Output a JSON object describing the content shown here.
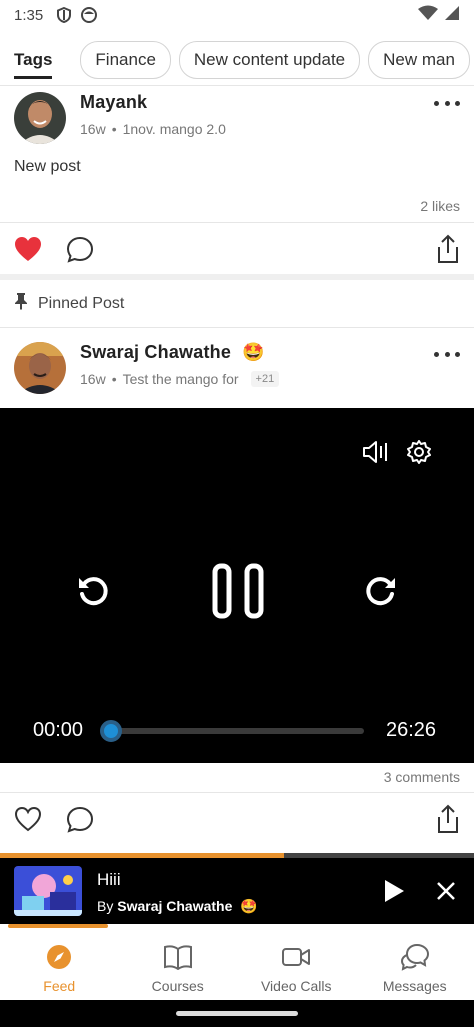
{
  "status": {
    "time": "1:35"
  },
  "tags": {
    "title": "Tags",
    "chips": [
      "Finance",
      "New content update",
      "New man"
    ]
  },
  "post1": {
    "author": "Mayank",
    "age": "16w",
    "community": "1nov. mango 2.0",
    "text": "New post",
    "likes": "2 likes"
  },
  "pinned": {
    "label": "Pinned Post"
  },
  "post2": {
    "author": "Swaraj Chawathe",
    "emoji": "🤩",
    "age": "16w",
    "community": "Test the mango for",
    "extra": "+21",
    "comments": "3 comments"
  },
  "video": {
    "current": "00:00",
    "duration": "26:26",
    "progress": 0.0
  },
  "mini_player": {
    "title": "Hiii",
    "by_prefix": "By",
    "author": "Swaraj Chawathe",
    "emoji": "🤩",
    "progress": 0.6
  },
  "nav": {
    "items": [
      {
        "label": "Feed",
        "icon": "compass-icon",
        "active": true
      },
      {
        "label": "Courses",
        "icon": "book-icon",
        "active": false
      },
      {
        "label": "Video Calls",
        "icon": "video-camera-icon",
        "active": false
      },
      {
        "label": "Messages",
        "icon": "chat-bubbles-icon",
        "active": false
      }
    ]
  },
  "colors": {
    "accent": "#e8922e",
    "like_red": "#e8323c",
    "progress_blue": "#1e8fd6"
  }
}
